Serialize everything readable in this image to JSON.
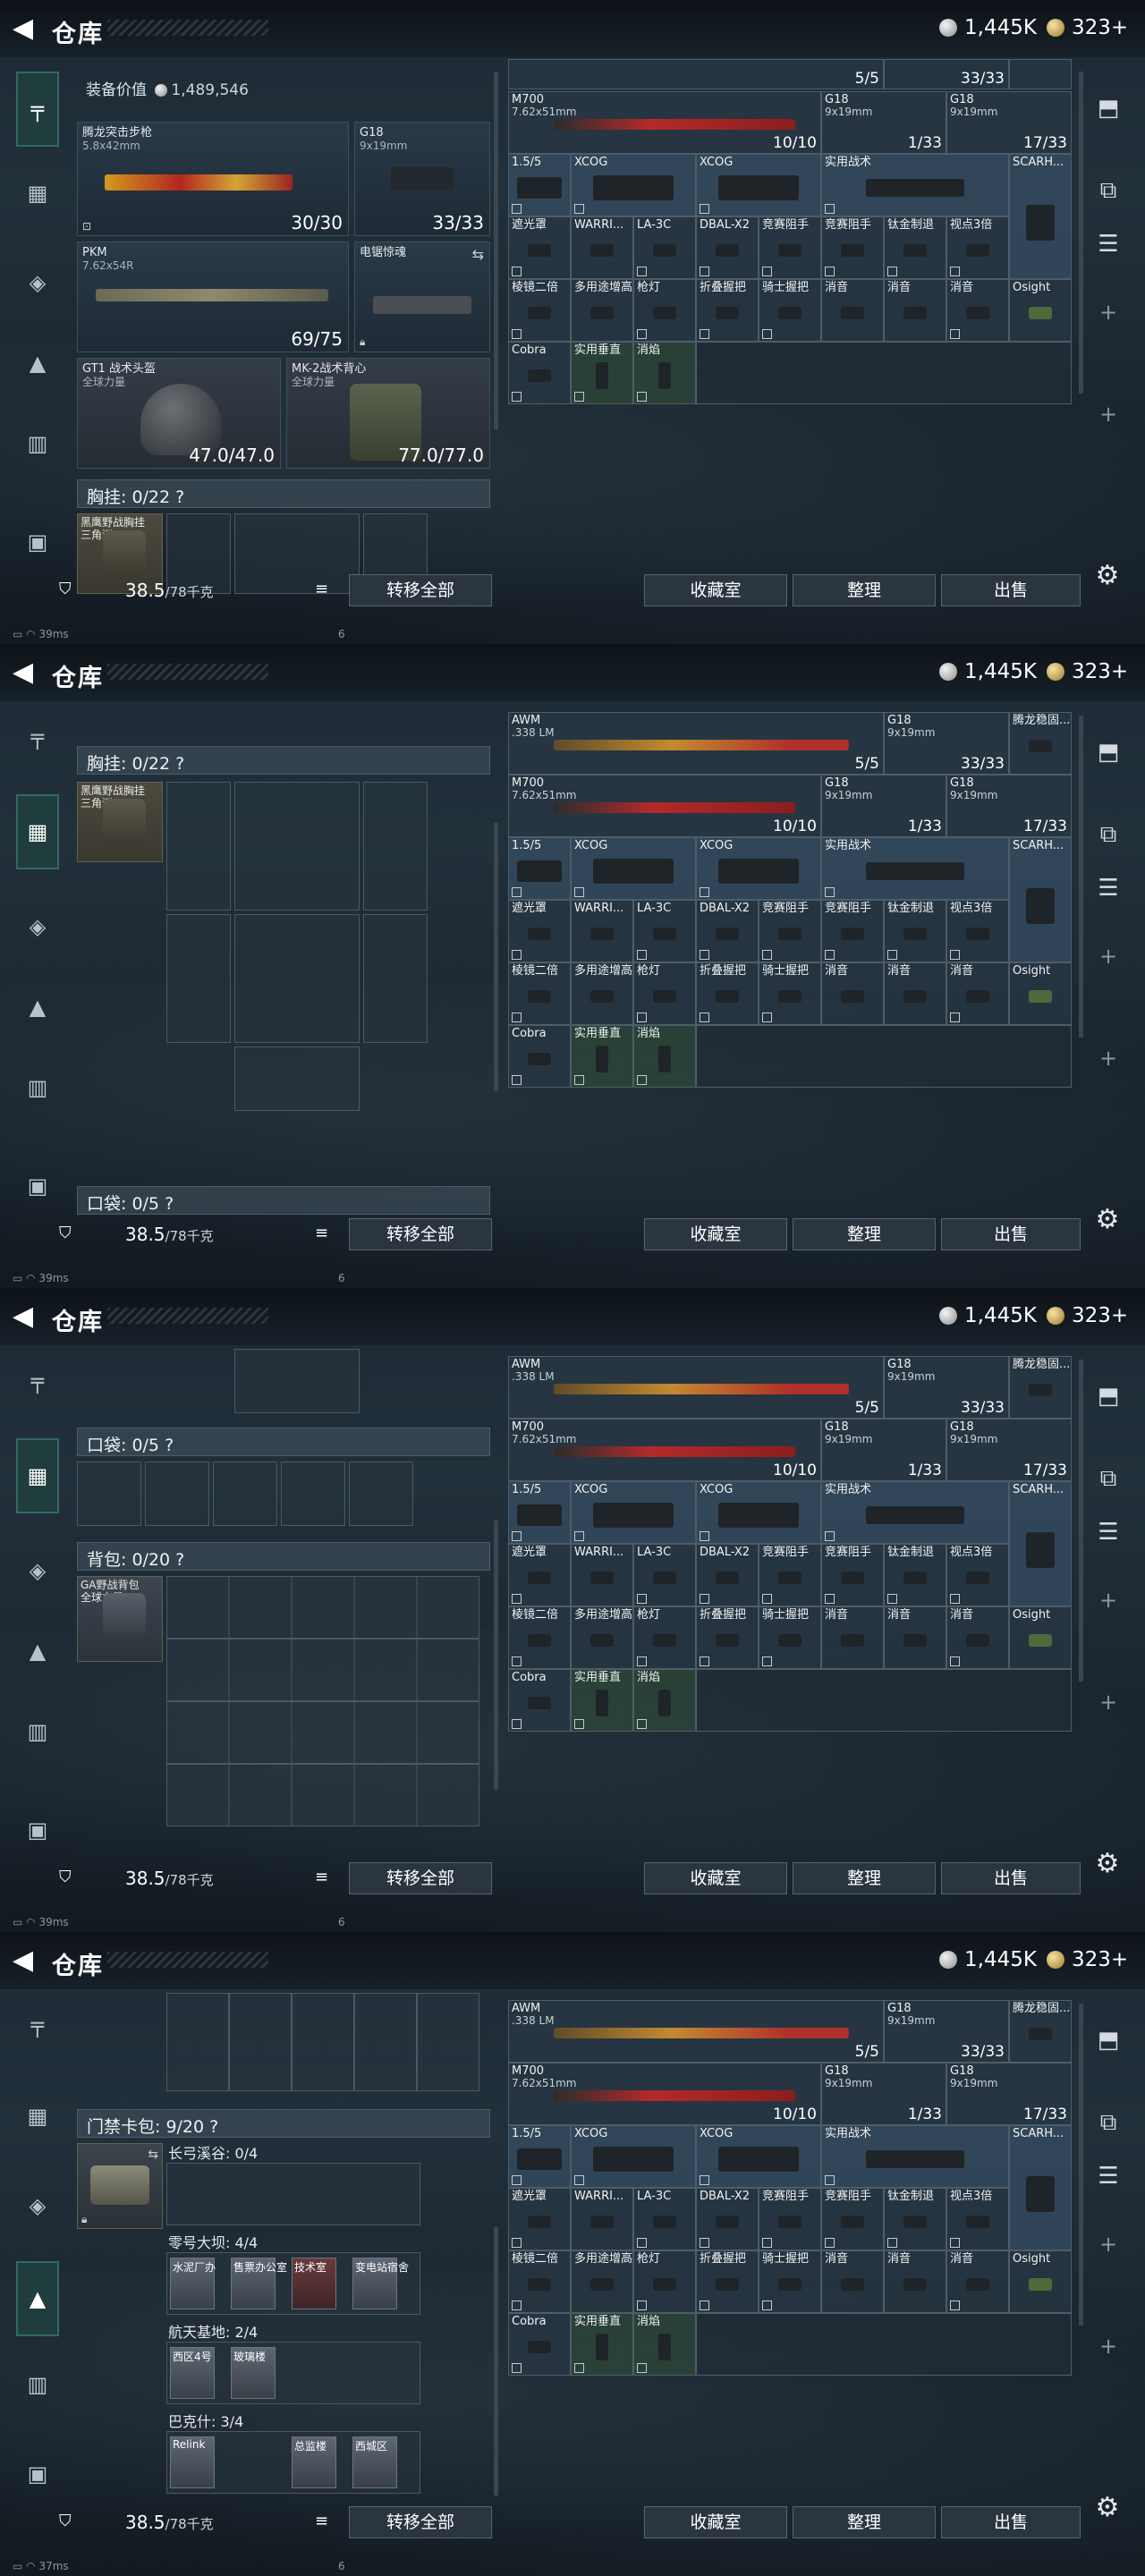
{
  "title": "仓库",
  "currency": {
    "silver": "1,445K",
    "gold": "323+"
  },
  "equip_label": "装备价值",
  "equip_value": "1,489,546",
  "loadout": {
    "rifle": {
      "name": "腾龙突击步枪",
      "caliber": "5.8x42mm",
      "count": "30/30"
    },
    "pistol": {
      "name": "G18",
      "caliber": "9x19mm",
      "count": "33/33"
    },
    "mg": {
      "name": "PKM",
      "caliber": "7.62x54R",
      "count": "69/75"
    },
    "melee": {
      "name": "电锯惊魂"
    },
    "helmet": {
      "name": "GT1 战术头盔",
      "sub": "全球力量",
      "dur": "47.0/47.0"
    },
    "armor": {
      "name": "MK-2战术背心",
      "sub": "全球力量",
      "dur": "77.0/77.0"
    }
  },
  "sections": {
    "chest": "胸挂: 0/22",
    "chest_item": "黑鹰野战胸挂",
    "chest_sub": "三角洲",
    "pocket": "口袋: 0/5",
    "backpack": "背包: 0/20",
    "backpack_item": "GA野战背包",
    "backpack_sub": "全球力量",
    "keycard": "门禁卡包: 9/20",
    "help": "?"
  },
  "keycard_groups": [
    {
      "label": "长弓溪谷: 0/4",
      "cards": []
    },
    {
      "label": "零号大坝: 4/4",
      "cards": [
        "水泥厂办",
        "售票办公室",
        "技术室",
        "变电站宿舍"
      ]
    },
    {
      "label": "航天基地: 2/4",
      "cards": [
        "西区4号",
        "玻璃楼"
      ]
    },
    {
      "label": "巴克什: 3/4",
      "cards": [
        "Relink",
        "总监楼",
        "西城区"
      ]
    }
  ],
  "grid_items": [
    {
      "n": "AWM",
      "s": ".338 LM",
      "c": "5/5",
      "lk": true,
      "wide": true,
      "img": "#c38a2e"
    },
    {
      "n": "G18",
      "s": "9x19mm",
      "c": "33/33",
      "lk": false
    },
    {
      "n": "腾龙稳固...",
      "s": "",
      "c": "",
      "lk": false
    },
    {
      "n": "M700",
      "s": "7.62x51mm",
      "c": "10/10",
      "lk": false,
      "wide": true,
      "img": "#a4242a"
    },
    {
      "n": "G18",
      "s": "9x19mm",
      "c": "1/33",
      "lk": false
    },
    {
      "n": "G18",
      "s": "9x19mm",
      "c": "17/33",
      "lk": false
    },
    {
      "n": "1.5/5",
      "s": "",
      "c": "",
      "lk": true
    },
    {
      "n": "XCOG",
      "s": "",
      "c": "",
      "lk": true
    },
    {
      "n": "XCOG",
      "s": "",
      "c": "",
      "lk": true
    },
    {
      "n": "实用战术",
      "s": "",
      "c": "",
      "lk": true
    },
    {
      "n": "SCARH...",
      "s": "",
      "c": "",
      "lk": false
    },
    {
      "n": "遮光罩",
      "s": "",
      "c": "",
      "lk": true
    },
    {
      "n": "WARRI...",
      "s": "",
      "c": "",
      "lk": false
    },
    {
      "n": "LA-3C",
      "s": "",
      "c": "",
      "lk": true
    },
    {
      "n": "DBAL-X2",
      "s": "",
      "c": "",
      "lk": true
    },
    {
      "n": "竞赛阻手",
      "s": "",
      "c": "",
      "lk": true
    },
    {
      "n": "竞赛阻手",
      "s": "",
      "c": "",
      "lk": true
    },
    {
      "n": "钛金制退",
      "s": "",
      "c": "",
      "lk": true
    },
    {
      "n": "视点3倍",
      "s": "",
      "c": "",
      "lk": true
    },
    {
      "n": "棱镜二倍",
      "s": "",
      "c": "",
      "lk": true
    },
    {
      "n": "多用途增高",
      "s": "",
      "c": "",
      "lk": false
    },
    {
      "n": "枪灯",
      "s": "",
      "c": "",
      "lk": true
    },
    {
      "n": "折叠握把",
      "s": "",
      "c": "",
      "lk": true
    },
    {
      "n": "骑士握把",
      "s": "",
      "c": "",
      "lk": true
    },
    {
      "n": "消音",
      "s": "",
      "c": "",
      "lk": false
    },
    {
      "n": "消音",
      "s": "",
      "c": "",
      "lk": false
    },
    {
      "n": "消音",
      "s": "",
      "c": "",
      "lk": true
    },
    {
      "n": "Osight",
      "s": "",
      "c": "",
      "lk": false
    },
    {
      "n": "Cobra",
      "s": "",
      "c": "",
      "lk": true
    },
    {
      "n": "实用垂直",
      "s": "",
      "c": "",
      "lk": true
    },
    {
      "n": "消焰",
      "s": "",
      "c": "",
      "lk": true
    }
  ],
  "bottom": {
    "weight": "38.5",
    "weight_unit": "/78千克",
    "transfer_all": "转移全部",
    "collection": "收藏室",
    "organize": "整理",
    "sell": "出售"
  },
  "status_ping": [
    "39ms",
    "39ms",
    "39ms",
    "37ms"
  ],
  "status_6": "6"
}
